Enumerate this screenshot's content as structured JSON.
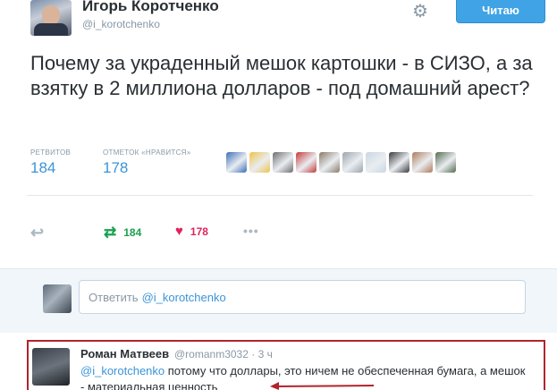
{
  "tweet": {
    "author_name": "Игорь Коротченко",
    "author_handle": "@i_korotchenko",
    "follow_button": "Читаю",
    "text": "Почему за украденный мешок картошки - в СИЗО, а за взятку в 2 миллиона долларов - под домашний арест?",
    "retweets_label": "РЕТВИТОВ",
    "retweets_count": "184",
    "likes_label": "ОТМЕТОК «НРАВИТСЯ»",
    "likes_count": "178",
    "liker_avatar_colors": [
      "#3b6fb6",
      "#f0c24b",
      "#6d6d6d",
      "#c43b3b",
      "#8a7a6a",
      "#9aa3ad",
      "#c9d6e3",
      "#3a3a3a",
      "#b07a5a",
      "#556b4f"
    ]
  },
  "actions": {
    "reply_icon": "reply-arrow-icon",
    "retweet_icon": "retweet-icon",
    "retweet_count": "184",
    "like_icon": "heart-icon",
    "like_count": "178",
    "more_icon": "ellipsis-icon",
    "more_text": "•••"
  },
  "reply_composer": {
    "prefix": "Ответить",
    "mention": "@i_korotchenko"
  },
  "reply": {
    "author_name": "Роман Матвеев",
    "author_handle": "@romanm3032",
    "separator": "·",
    "time": "3 ч",
    "mention": "@i_korotchenko",
    "text": "потому что доллары, это ничем не обеспеченная бумага, а мешок - материальная ценность"
  },
  "colors": {
    "accent": "#3b94d9",
    "follow_bg": "#3fa3e6",
    "retweet": "#19a14f",
    "like": "#e0245e",
    "highlight_frame": "#b2242c"
  }
}
